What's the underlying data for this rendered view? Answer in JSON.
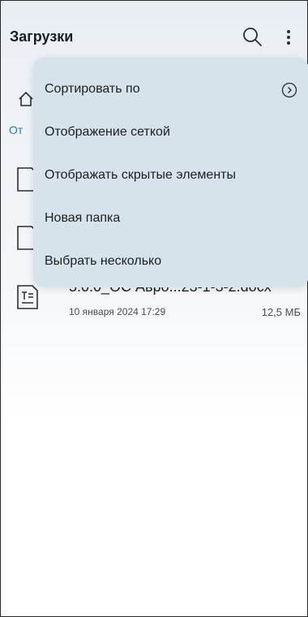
{
  "appbar": {
    "title": "Загрузки"
  },
  "breadcrumb": {
    "text": "От"
  },
  "menu": {
    "items": [
      {
        "label": "Сортировать по"
      },
      {
        "label": "Отображение сеткой"
      },
      {
        "label": "Отображать скрытые элементы"
      },
      {
        "label": "Новая папка"
      },
      {
        "label": "Выбрать несколько"
      }
    ]
  },
  "files": [
    {
      "name": "5.0.0_ОС Авро...23-1-3-2.docx",
      "date": "10 января 2024 17:29",
      "size": "12,5 МБ"
    }
  ],
  "icons": {
    "search": "search-icon",
    "more": "more-vert-icon",
    "home": "home-icon",
    "document": "document-icon",
    "chevron": "chevron-right-circle-icon"
  }
}
